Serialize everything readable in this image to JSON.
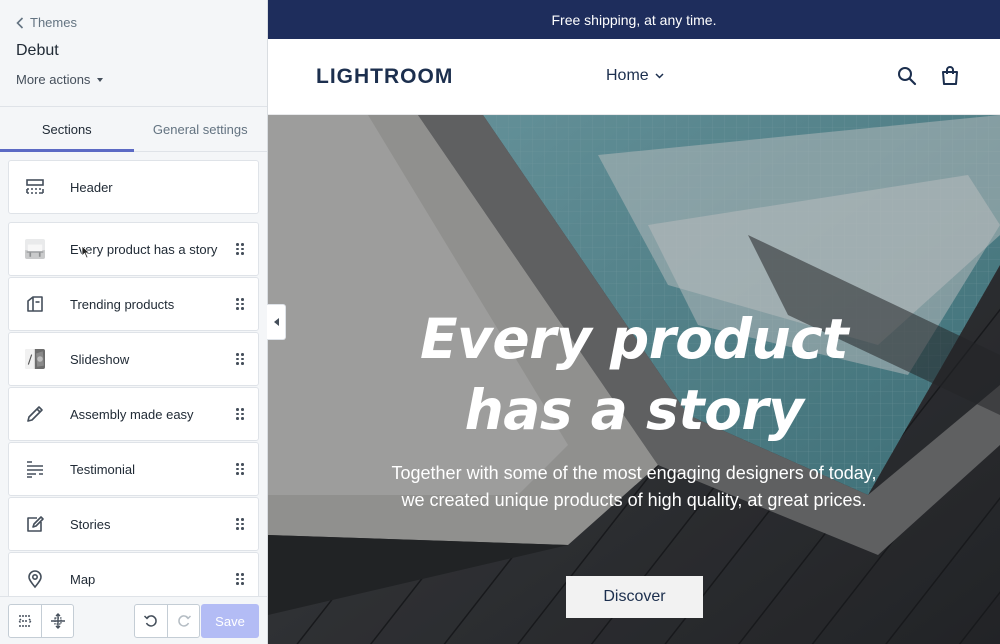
{
  "sidebar": {
    "back_label": "Themes",
    "theme_name": "Debut",
    "more_actions": "More actions",
    "tabs": [
      {
        "label": "Sections",
        "active": true
      },
      {
        "label": "General settings",
        "active": false
      }
    ],
    "header_section": {
      "label": "Header",
      "icon": "header-layout-icon"
    },
    "sections": [
      {
        "label": "Every product has a story",
        "icon": "image-thumbnail"
      },
      {
        "label": "Trending products",
        "icon": "collection-icon"
      },
      {
        "label": "Slideshow",
        "icon": "slideshow-thumbnail"
      },
      {
        "label": "Assembly made easy",
        "icon": "pencil-icon"
      },
      {
        "label": "Testimonial",
        "icon": "text-lines-icon"
      },
      {
        "label": "Stories",
        "icon": "compose-icon"
      },
      {
        "label": "Map",
        "icon": "location-pin-icon"
      }
    ],
    "footer": {
      "save_label": "Save",
      "accent_disabled": "#b3bcf5"
    }
  },
  "preview": {
    "announcement": "Free shipping, at any time.",
    "logo": "LIGHTROOM",
    "nav_home": "Home",
    "hero": {
      "title": "Every product has a story",
      "text": "Together with some of the most engaging designers of today, we created unique products of high quality, at great prices.",
      "button": "Discover"
    },
    "colors": {
      "announcement_bg": "#1e2d5c",
      "brand_text": "#1c2f4e"
    }
  }
}
